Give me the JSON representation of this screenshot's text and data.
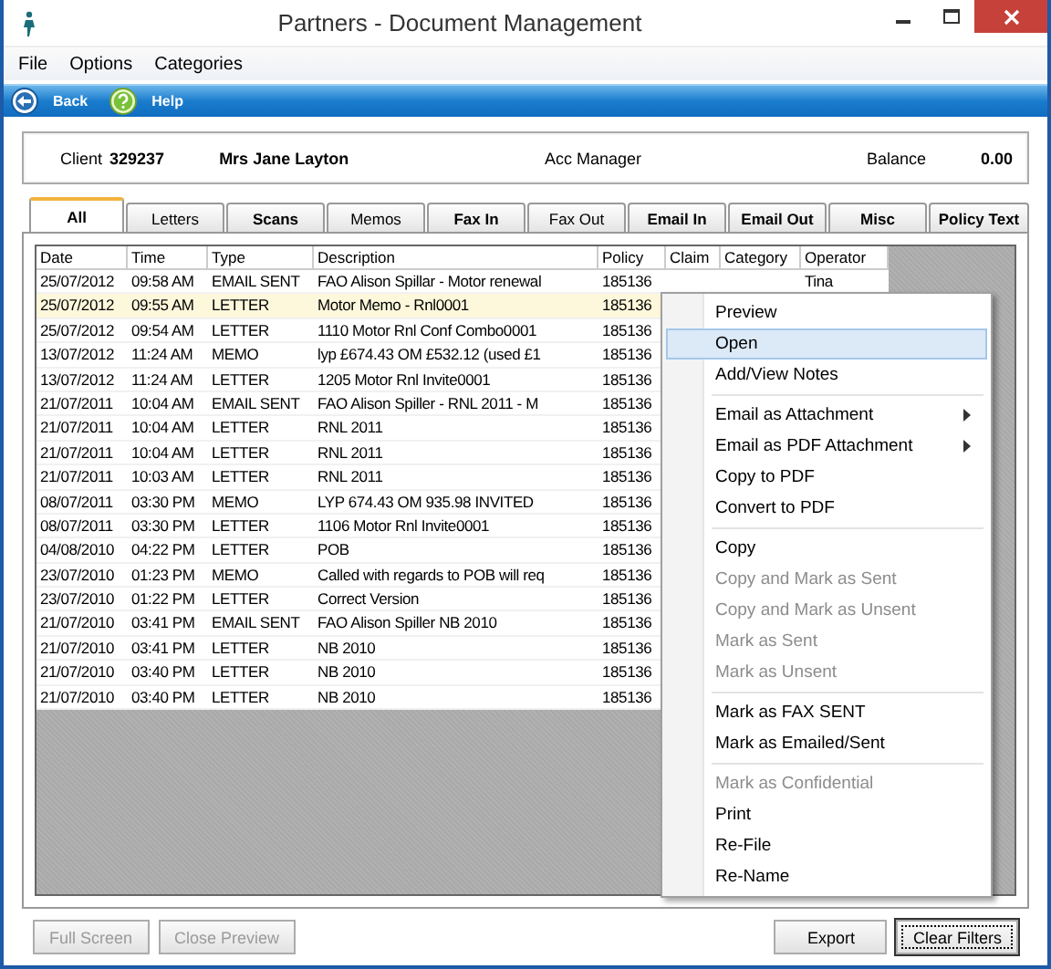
{
  "window": {
    "title": "Partners - Document Management"
  },
  "menu": [
    "File",
    "Options",
    "Categories"
  ],
  "toolbar": [
    "Back",
    "Help"
  ],
  "client": {
    "label": "Client",
    "number": "329237",
    "name": "Mrs Jane Layton",
    "manager_label": "Acc Manager",
    "balance_label": "Balance",
    "balance": "0.00"
  },
  "tabs": [
    {
      "label": "All",
      "selected": true,
      "bold": true
    },
    {
      "label": "Letters",
      "selected": false,
      "bold": false
    },
    {
      "label": "Scans",
      "selected": false,
      "bold": true
    },
    {
      "label": "Memos",
      "selected": false,
      "bold": false
    },
    {
      "label": "Fax In",
      "selected": false,
      "bold": true
    },
    {
      "label": "Fax Out",
      "selected": false,
      "bold": false
    },
    {
      "label": "Email In",
      "selected": false,
      "bold": true
    },
    {
      "label": "Email Out",
      "selected": false,
      "bold": true
    },
    {
      "label": "Misc",
      "selected": false,
      "bold": true
    },
    {
      "label": "Policy Text",
      "selected": false,
      "bold": true
    }
  ],
  "table": {
    "columns": [
      "Date",
      "Time",
      "Type",
      "Description",
      "Policy",
      "Claim",
      "Category",
      "Operator"
    ],
    "rows": [
      {
        "date": "25/07/2012",
        "time": "09:58 AM",
        "type": "EMAIL SENT",
        "description": "FAO Alison Spillar - Motor renewal",
        "policy": "185136",
        "operator": "Tina",
        "selected": false
      },
      {
        "date": "25/07/2012",
        "time": "09:55 AM",
        "type": "LETTER",
        "description": "Motor Memo - Rnl0001",
        "policy": "185136",
        "selected": true
      },
      {
        "date": "25/07/2012",
        "time": "09:54 AM",
        "type": "LETTER",
        "description": "1110 Motor Rnl Conf Combo0001",
        "policy": "185136",
        "selected": false
      },
      {
        "date": "13/07/2012",
        "time": "11:24 AM",
        "type": "MEMO",
        "description": "lyp £674.43 OM £532.12 (used £1",
        "policy": "185136",
        "selected": false
      },
      {
        "date": "13/07/2012",
        "time": "11:24 AM",
        "type": "LETTER",
        "description": "1205 Motor Rnl Invite0001",
        "policy": "185136",
        "selected": false
      },
      {
        "date": "21/07/2011",
        "time": "10:04 AM",
        "type": "EMAIL SENT",
        "description": "FAO Alison Spiller - RNL 2011 - M",
        "policy": "185136",
        "selected": false
      },
      {
        "date": "21/07/2011",
        "time": "10:04 AM",
        "type": "LETTER",
        "description": "RNL 2011",
        "policy": "185136",
        "selected": false
      },
      {
        "date": "21/07/2011",
        "time": "10:04 AM",
        "type": "LETTER",
        "description": "RNL 2011",
        "policy": "185136",
        "selected": false
      },
      {
        "date": "21/07/2011",
        "time": "10:03 AM",
        "type": "LETTER",
        "description": "RNL 2011",
        "policy": "185136",
        "selected": false
      },
      {
        "date": "08/07/2011",
        "time": "03:30 PM",
        "type": "MEMO",
        "description": "LYP 674.43 OM 935.98 INVITED",
        "policy": "185136",
        "selected": false
      },
      {
        "date": "08/07/2011",
        "time": "03:30 PM",
        "type": "LETTER",
        "description": "1106 Motor Rnl Invite0001",
        "policy": "185136",
        "selected": false
      },
      {
        "date": "04/08/2010",
        "time": "04:22 PM",
        "type": "LETTER",
        "description": "POB",
        "policy": "185136",
        "selected": false
      },
      {
        "date": "23/07/2010",
        "time": "01:23 PM",
        "type": "MEMO",
        "description": "Called with regards to POB will req",
        "policy": "185136",
        "selected": false
      },
      {
        "date": "23/07/2010",
        "time": "01:22 PM",
        "type": "LETTER",
        "description": "Correct Version",
        "policy": "185136",
        "selected": false
      },
      {
        "date": "21/07/2010",
        "time": "03:41 PM",
        "type": "EMAIL SENT",
        "description": "FAO Alison Spiller NB 2010",
        "policy": "185136",
        "selected": false
      },
      {
        "date": "21/07/2010",
        "time": "03:41 PM",
        "type": "LETTER",
        "description": "NB 2010",
        "policy": "185136",
        "selected": false
      },
      {
        "date": "21/07/2010",
        "time": "03:40 PM",
        "type": "LETTER",
        "description": "NB 2010",
        "policy": "185136",
        "selected": false
      },
      {
        "date": "21/07/2010",
        "time": "03:40 PM",
        "type": "LETTER",
        "description": "NB 2010",
        "policy": "185136",
        "selected": false
      }
    ]
  },
  "context_menu": [
    {
      "kind": "item",
      "label": "Preview",
      "disabled": false,
      "selected": false
    },
    {
      "kind": "item",
      "label": "Open",
      "disabled": false,
      "selected": true
    },
    {
      "kind": "item",
      "label": "Add/View Notes",
      "disabled": false,
      "selected": false
    },
    {
      "kind": "separator"
    },
    {
      "kind": "submenu",
      "label": "Email as Attachment",
      "disabled": false,
      "selected": false
    },
    {
      "kind": "submenu",
      "label": "Email as PDF Attachment",
      "disabled": false,
      "selected": false
    },
    {
      "kind": "item",
      "label": "Copy to PDF",
      "disabled": false,
      "selected": false
    },
    {
      "kind": "item",
      "label": "Convert to PDF",
      "disabled": false,
      "selected": false
    },
    {
      "kind": "separator"
    },
    {
      "kind": "item",
      "label": "Copy",
      "disabled": false,
      "selected": false
    },
    {
      "kind": "item",
      "label": "Copy and Mark as Sent",
      "disabled": true,
      "selected": false
    },
    {
      "kind": "item",
      "label": "Copy and Mark as Unsent",
      "disabled": true,
      "selected": false
    },
    {
      "kind": "item",
      "label": "Mark as Sent",
      "disabled": true,
      "selected": false
    },
    {
      "kind": "item",
      "label": "Mark as Unsent",
      "disabled": true,
      "selected": false
    },
    {
      "kind": "separator"
    },
    {
      "kind": "item",
      "label": "Mark as FAX SENT",
      "disabled": false,
      "selected": false
    },
    {
      "kind": "item",
      "label": "Mark as Emailed/Sent",
      "disabled": false,
      "selected": false
    },
    {
      "kind": "separator"
    },
    {
      "kind": "item",
      "label": "Mark as Confidential",
      "disabled": true,
      "selected": false
    },
    {
      "kind": "item",
      "label": "Print",
      "disabled": false,
      "selected": false
    },
    {
      "kind": "item",
      "label": "Re-File",
      "disabled": false,
      "selected": false
    },
    {
      "kind": "item",
      "label": "Re-Name",
      "disabled": false,
      "selected": false
    }
  ],
  "footer": [
    {
      "label": "Full Screen",
      "disabled": true,
      "focused": false
    },
    {
      "label": "Close Preview",
      "disabled": true,
      "focused": false
    },
    {
      "label": "Export",
      "disabled": false,
      "focused": false
    },
    {
      "label": "Clear Filters",
      "disabled": false,
      "focused": true
    }
  ]
}
